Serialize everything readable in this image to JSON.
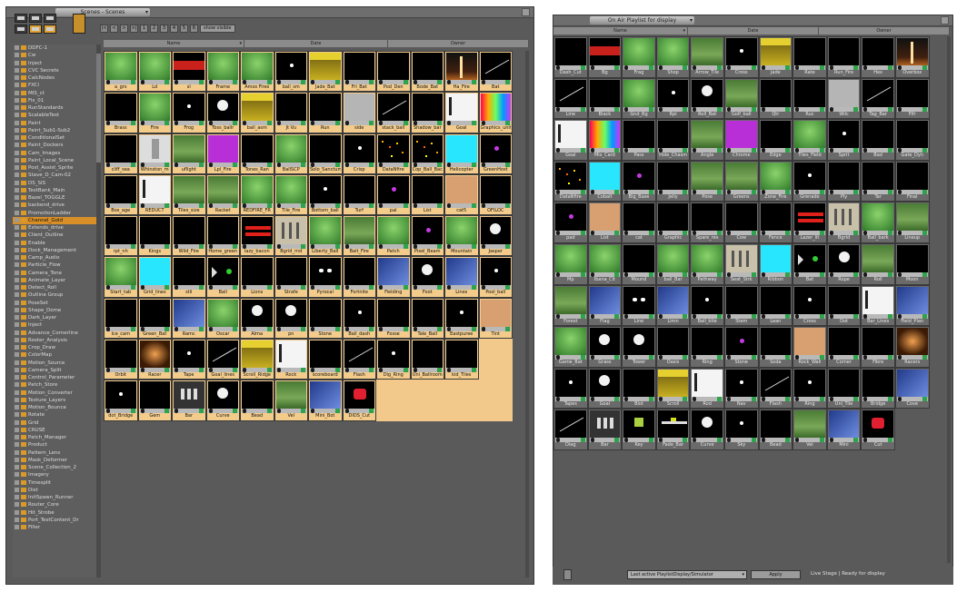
{
  "left_panel": {
    "title": "Scenes - Scenes",
    "columns": [
      "Name",
      "Date",
      "Owner"
    ],
    "nav": [
      "|<",
      "<",
      ">",
      ">|",
      "1",
      "2",
      "3",
      "4",
      "5",
      "6"
    ],
    "nav_text": "show visible",
    "tree": [
      "DDFC-1",
      "Cw",
      "Inject",
      "CVC Secrets",
      "CalcNodes",
      "FXCI",
      "MIS_ct",
      "Fix_01",
      "RunStandards",
      "ScalableTest",
      "Paint",
      "Paint_Sub1-Sub2",
      "ConditionalSet",
      "Paint_Dockers",
      "Cam_Images",
      "Paint_Local_Scene",
      "Post_Assist_Sprite",
      "Stave_D_Cam-02",
      "DS_SIS",
      "TestBank_Main",
      "Bazel_TOGGLE",
      "backend_drive",
      "PromotionLadder",
      "Channel_Gold",
      "Extends_drive",
      "Client_Outline",
      "Enable",
      "Dock_Management",
      "Camp_Audio",
      "Particle_Flow",
      "Camera_Tone",
      "Animate_Layer",
      "Detect_Roll",
      "Outline Group",
      "PoseSet",
      "Shape_Dome",
      "Dark_Layer",
      "Inject",
      "Advance_Cornerline",
      "Roster_Analysis",
      "Crop_Draw",
      "ColorMap",
      "Motion_Source",
      "Camera_Split",
      "Control_Parameter",
      "Patch_Store",
      "Motion_Converter",
      "Texture_Layers",
      "Motion_Bounce",
      "Rotate",
      "Grid",
      "CRUSE",
      "Patch_Manager",
      "Product",
      "Pattern_Lens",
      "Mask_Deformer",
      "Scene_Collection_2",
      "Imagery",
      "Timesplit",
      "Dist",
      "InitSpawn_Runner",
      "Router_Core",
      "Hit_Strobe",
      "Port_TestContent_Dr",
      "Filler"
    ],
    "selected_index": 23,
    "cells": [
      [
        "s_a_grass",
        "green",
        "a_grs"
      ],
      [
        "s_b_green",
        "green",
        "Ld"
      ],
      [
        "s_c_red",
        "redband",
        "sl"
      ],
      [
        "s_d_green",
        "green",
        "Frame"
      ],
      [
        "s_e_grass",
        "green",
        "Amos Fires"
      ],
      [
        "s_f_dot",
        "dot",
        "ball_sm"
      ],
      [
        "s_g_yellow",
        "yellow",
        "Jade_Bat"
      ],
      [
        "s_h_black",
        "black",
        "Frl_Bat"
      ],
      [
        "s_i_black",
        "black",
        "Pod_Den"
      ],
      [
        "s_j_black",
        "black",
        "Bode_Bat"
      ],
      [
        "s_k_stage",
        "stage",
        "Ha_Fire"
      ],
      [
        "s_l_line",
        "line",
        "Bat"
      ],
      [
        "s_m1",
        "black",
        "Brass"
      ],
      [
        "s_m2",
        "green",
        "Fire"
      ],
      [
        "s_m3",
        "dot",
        "Frog"
      ],
      [
        "s_m4",
        "ball",
        "Toss_ballr"
      ],
      [
        "s_m5",
        "yellow",
        "ball_asm"
      ],
      [
        "s_m6",
        "black",
        "Jt Vu"
      ],
      [
        "s_m7",
        "black",
        "Run"
      ],
      [
        "s_m8",
        "grey",
        "side"
      ],
      [
        "s_m9",
        "line",
        "stack_ball"
      ],
      [
        "s_m10",
        "black",
        "Shadow_bar"
      ],
      [
        "s_m11",
        "white",
        "Goal"
      ],
      [
        "s_m12",
        "color",
        "Graphics_unit"
      ],
      [
        "s_n1",
        "black",
        "cliff_sea"
      ],
      [
        "s_n2",
        "whitefig",
        "Whinston_m"
      ],
      [
        "s_n3",
        "grass2",
        "uflight"
      ],
      [
        "s_n4",
        "magenta",
        "Lpl_Fire"
      ],
      [
        "s_n5",
        "black",
        "Tones_Ran"
      ],
      [
        "s_n6",
        "green",
        "BallSCP"
      ],
      [
        "s_n7",
        "black",
        "Solo_Sanctum"
      ],
      [
        "s_n8",
        "dot",
        "Crisp"
      ],
      [
        "s_n9",
        "stars",
        "DataNfire"
      ],
      [
        "s_n10",
        "stars",
        "Cop_Ball_Bac"
      ],
      [
        "s_n11",
        "cyan",
        "Helicopter"
      ],
      [
        "s_n12",
        "purple",
        "GreenHost"
      ],
      [
        "s_o1",
        "black",
        "Bos_age"
      ],
      [
        "s_o2",
        "white",
        "REDUCT"
      ],
      [
        "s_o3",
        "grass2",
        "Tiles_size"
      ],
      [
        "s_o4",
        "grass2",
        "Racket"
      ],
      [
        "s_o5",
        "green",
        "REDFIRE_FR"
      ],
      [
        "s_o6",
        "green",
        "Tile_Fire"
      ],
      [
        "s_o7",
        "dot",
        "Bottom_ball"
      ],
      [
        "s_o8",
        "black",
        "Turf"
      ],
      [
        "s_o9",
        "purple",
        "pal"
      ],
      [
        "s_o10",
        "black",
        "List"
      ],
      [
        "s_o11",
        "tan",
        "cat5"
      ],
      [
        "s_o12",
        "black",
        "OFILOC"
      ],
      [
        "s_p1",
        "black",
        "rpt_nh"
      ],
      [
        "s_p2",
        "black",
        "Kings"
      ],
      [
        "s_p3",
        "black",
        "Wild_Fire"
      ],
      [
        "s_p4",
        "black",
        "Home_green"
      ],
      [
        "s_p5",
        "redlines",
        "lazy_bacon"
      ],
      [
        "s_p6",
        "figs",
        "Bgrid_rnd"
      ],
      [
        "s_p7",
        "green",
        "Liberty_Ball"
      ],
      [
        "s_p8",
        "grass2",
        "Bait_Fire"
      ],
      [
        "s_p9",
        "green",
        "Patch"
      ],
      [
        "s_p10",
        "purple",
        "Pixel_Beam"
      ],
      [
        "s_p11",
        "green",
        "Mountain"
      ],
      [
        "s_p12",
        "ball",
        "Jasper"
      ],
      [
        "s_q1",
        "green",
        "Start_tab"
      ],
      [
        "s_q2",
        "cyan",
        "Grid_lines"
      ],
      [
        "s_q3",
        "black",
        "stil"
      ],
      [
        "s_q4",
        "arrow",
        "Ball"
      ],
      [
        "s_q5",
        "black",
        "Lions"
      ],
      [
        "s_q6",
        "black",
        "Strafe"
      ],
      [
        "s_q7",
        "eyes",
        "Pyrocal"
      ],
      [
        "s_q8",
        "black",
        "Fortnite"
      ],
      [
        "s_q9",
        "blue",
        "Fielding"
      ],
      [
        "s_q10",
        "ball",
        "Foot"
      ],
      [
        "s_q11",
        "blue",
        "Lines"
      ],
      [
        "s_q12",
        "dot",
        "Pool_ball"
      ],
      [
        "s_r1",
        "black",
        "Ice_cam"
      ],
      [
        "s_r2",
        "black",
        "Green_Bat"
      ],
      [
        "s_r3",
        "blue",
        "Ramc"
      ],
      [
        "s_r4",
        "green",
        "Oscar"
      ],
      [
        "s_r5",
        "ball",
        "Alma"
      ],
      [
        "s_r6",
        "ball",
        "pn"
      ],
      [
        "s_r7",
        "black",
        "Stone"
      ],
      [
        "s_r8",
        "dot",
        "Ball_dash"
      ],
      [
        "s_r9",
        "black",
        "Fosse"
      ],
      [
        "s_r10",
        "black",
        "Tale_Ball"
      ],
      [
        "s_r11",
        "dot",
        "Eastpuree"
      ],
      [
        "s_r12",
        "tan",
        "Tint"
      ],
      [
        "s_s1",
        "black",
        "Orbit"
      ],
      [
        "s_s2",
        "orange",
        "Racer"
      ],
      [
        "s_s3",
        "dot",
        "Tape"
      ],
      [
        "s_s4",
        "line",
        "Goal_lines"
      ],
      [
        "s_s5",
        "yellow",
        "Scroll_Ridge"
      ],
      [
        "s_s6",
        "white",
        "Rock"
      ],
      [
        "s_s7",
        "black",
        "scoreboard"
      ],
      [
        "s_s8",
        "line",
        "Flash"
      ],
      [
        "s_s9",
        "dot",
        "Dig_Ring"
      ],
      [
        "s_s10",
        "black",
        "Uni_Ballroom"
      ],
      [
        "s_s11",
        "black",
        "kid_Tiles"
      ],
      [
        "s_s12",
        "",
        "",
        true
      ],
      [
        "s_t1",
        "dot",
        "dot_Bridge"
      ],
      [
        "s_t2",
        "black",
        "Gem"
      ],
      [
        "s_t3",
        "bars",
        "Bar"
      ],
      [
        "s_t4",
        "ball",
        "Curve"
      ],
      [
        "s_t5",
        "black",
        "Bead"
      ],
      [
        "s_t6",
        "grass2",
        "Vel"
      ],
      [
        "s_t7",
        "blue",
        "Mini_Bot"
      ],
      [
        "s_t8",
        "redbox",
        "DIOS_Cut"
      ]
    ]
  },
  "right_panel": {
    "title": "On Air Playlist for display",
    "columns": [
      "Name",
      "Date",
      "Owner"
    ],
    "cells": [
      [
        "r1",
        "black",
        "Dash_Cut"
      ],
      [
        "r2",
        "redband",
        "Bg"
      ],
      [
        "r3",
        "green",
        "Frag"
      ],
      [
        "r4",
        "green",
        "Shop"
      ],
      [
        "r5",
        "grass2",
        "Arrow_Tile"
      ],
      [
        "r6",
        "dot",
        "Cross"
      ],
      [
        "r7",
        "yellow",
        "Jade"
      ],
      [
        "r8",
        "black",
        "Rate"
      ],
      [
        "r9",
        "black",
        "Run_Fire"
      ],
      [
        "r10",
        "black",
        "Hex"
      ],
      [
        "r11",
        "stage",
        "Overbox"
      ],
      [
        "r12",
        "line",
        "Line"
      ],
      [
        "r13",
        "black",
        "Black"
      ],
      [
        "r14",
        "green",
        "Gnd_Bg"
      ],
      [
        "r15",
        "dot",
        "Rpl"
      ],
      [
        "r16",
        "ball",
        "Roll_Bat"
      ],
      [
        "r17",
        "grass2",
        "Golf_ball"
      ],
      [
        "r18",
        "black",
        "Qtr"
      ],
      [
        "r19",
        "black",
        "Ruc"
      ],
      [
        "r20",
        "grey",
        "Wilc"
      ],
      [
        "r21",
        "line",
        "Tag_Bar"
      ],
      [
        "r22",
        "black",
        "Fifr"
      ],
      [
        "r23",
        "white",
        "Goal"
      ],
      [
        "r24",
        "color",
        "Mix_Card"
      ],
      [
        "r25",
        "black",
        "Pass"
      ],
      [
        "r26",
        "black",
        "Hole_Chasm"
      ],
      [
        "r27",
        "grass2",
        "Angle"
      ],
      [
        "r28",
        "magenta",
        "Chrome"
      ],
      [
        "r29",
        "black",
        "Edge"
      ],
      [
        "r30",
        "green",
        "Tiles_Field"
      ],
      [
        "r31",
        "dot",
        "Sprit"
      ],
      [
        "r32",
        "black",
        "Bad"
      ],
      [
        "r33",
        "black",
        "Gate_Dyn"
      ],
      [
        "r34",
        "stars",
        "DataNfire"
      ],
      [
        "r35",
        "cyan",
        "Cobalt"
      ],
      [
        "r36",
        "purple",
        "Big_Base"
      ],
      [
        "r37",
        "black",
        "Jelly"
      ],
      [
        "r38",
        "grass2",
        "Pose"
      ],
      [
        "r39",
        "grass2",
        "Greens"
      ],
      [
        "r40",
        "green",
        "Zone_Fire"
      ],
      [
        "r41",
        "dot",
        "Grenade"
      ],
      [
        "r42",
        "black",
        "Ply"
      ],
      [
        "r43",
        "black",
        "Tar"
      ],
      [
        "r44",
        "black",
        "Final"
      ],
      [
        "r45",
        "purple",
        "pad"
      ],
      [
        "r46",
        "tan",
        "List"
      ],
      [
        "r47",
        "black",
        "cat"
      ],
      [
        "r48",
        "black",
        "Graphic"
      ],
      [
        "r49",
        "black",
        "Spare_res"
      ],
      [
        "r50",
        "black",
        "Cow"
      ],
      [
        "r51",
        "black",
        "Fence"
      ],
      [
        "r52",
        "redlines",
        "Lazer_lit"
      ],
      [
        "r53",
        "figs",
        "Bgrid"
      ],
      [
        "r54",
        "green",
        "Ball_bark"
      ],
      [
        "r55",
        "grass2",
        "Lineup"
      ],
      [
        "r56",
        "green",
        "Mp"
      ],
      [
        "r57",
        "green",
        "Ibana_Cit"
      ],
      [
        "r58",
        "black",
        "Mound"
      ],
      [
        "r59",
        "green",
        "ball_Bar"
      ],
      [
        "r60",
        "green",
        "Pathway"
      ],
      [
        "r61",
        "figs",
        "Seat_Strk"
      ],
      [
        "r62",
        "cyan",
        "Ribbon"
      ],
      [
        "r63",
        "arrow",
        "Bat"
      ],
      [
        "r64",
        "ball",
        "Rope"
      ],
      [
        "r65",
        "grass2",
        "Roll"
      ],
      [
        "r66",
        "black",
        "Moon"
      ],
      [
        "r67",
        "grass2",
        "Forest"
      ],
      [
        "r68",
        "blue",
        "Flag"
      ],
      [
        "r69",
        "eyes",
        "Line"
      ],
      [
        "r70",
        "blue",
        "Limn"
      ],
      [
        "r71",
        "dot",
        "Ball_kite"
      ],
      [
        "r72",
        "black",
        "Stem"
      ],
      [
        "r73",
        "black",
        "Lean"
      ],
      [
        "r74",
        "dot",
        "Cross"
      ],
      [
        "r75",
        "black",
        "Dot"
      ],
      [
        "r76",
        "white",
        "Bar_Lines"
      ],
      [
        "r77",
        "blue",
        "Field_Plan"
      ],
      [
        "r78",
        "green",
        "Game_Bat"
      ],
      [
        "r79",
        "ball",
        "Grass"
      ],
      [
        "r80",
        "ball",
        "Tower"
      ],
      [
        "r81",
        "black",
        "Oasis"
      ],
      [
        "r82",
        "black",
        "Ring"
      ],
      [
        "r83",
        "purple",
        "Stone"
      ],
      [
        "r84",
        "black",
        "Soda"
      ],
      [
        "r85",
        "tan",
        "Rock_Wall"
      ],
      [
        "r86",
        "black",
        "Corner"
      ],
      [
        "r87",
        "black",
        "Fibre"
      ],
      [
        "r88",
        "orange",
        "Racers"
      ],
      [
        "r89",
        "dot",
        "Tapes"
      ],
      [
        "r90",
        "ball",
        "Goal"
      ],
      [
        "r91",
        "black",
        "Blot"
      ],
      [
        "r92",
        "yellow",
        "Scroll"
      ],
      [
        "r93",
        "white",
        "Rod"
      ],
      [
        "r94",
        "dot",
        "Nav"
      ],
      [
        "r95",
        "line",
        "Flash"
      ],
      [
        "r96",
        "dot",
        "Ring"
      ],
      [
        "r97",
        "black",
        "Uni_Tile"
      ],
      [
        "r98",
        "black",
        "Bridge"
      ],
      [
        "r99",
        "blue",
        "Cove"
      ],
      [
        "r100",
        "line",
        "Diag"
      ],
      [
        "r101",
        "bars",
        "Bar"
      ],
      [
        "r102",
        "greensq",
        "Key"
      ],
      [
        "r103",
        "bar2",
        "Fade_Bar"
      ],
      [
        "r104",
        "ball",
        "Curve"
      ],
      [
        "r105",
        "dot",
        "Sky"
      ],
      [
        "r106",
        "black",
        "Bead"
      ],
      [
        "r107",
        "grass2",
        "Vel"
      ],
      [
        "r108",
        "blue",
        "Mini"
      ],
      [
        "r109",
        "redbox",
        "Cut"
      ]
    ],
    "combo_value": "Last active PlaylistDisplay/Simulator",
    "apply_label": "Apply",
    "status_text": "Live Stage | Ready for display"
  },
  "colors": {
    "panel": "#5a5a5a",
    "selection": "#f3cc8c",
    "tree_selection": "#d98f28",
    "status_green": "#2fa34b"
  }
}
